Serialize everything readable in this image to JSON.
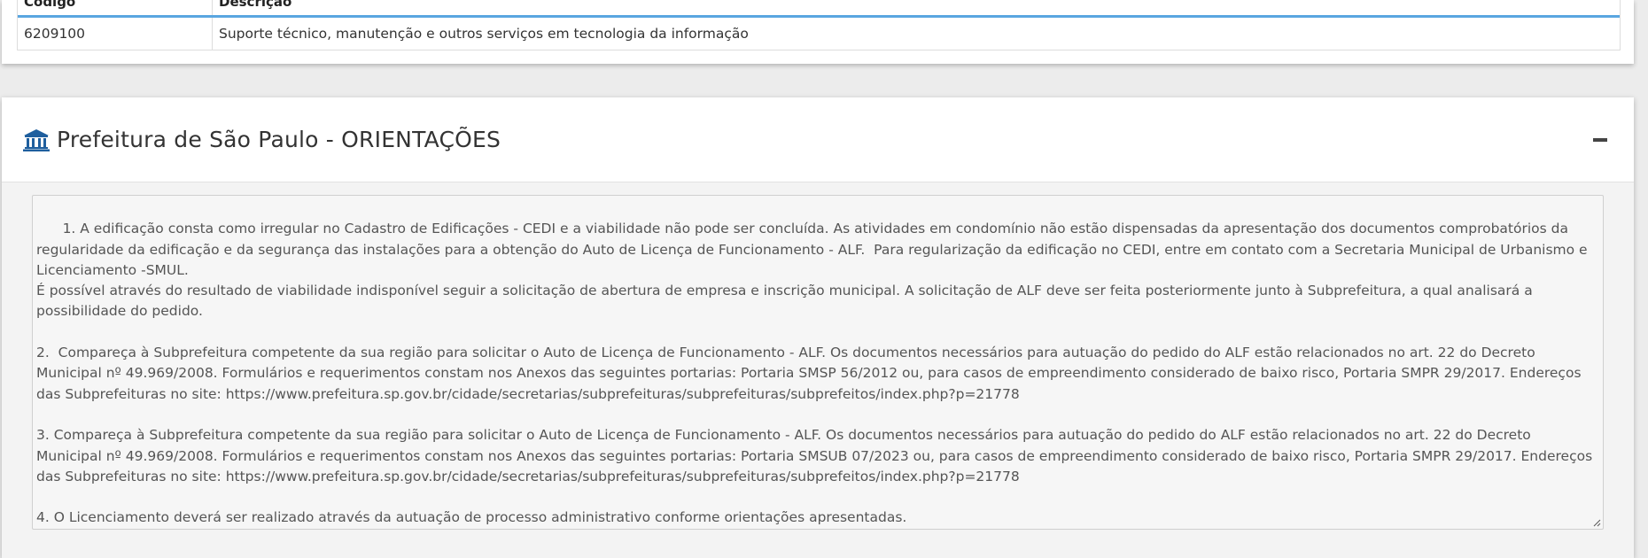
{
  "cnae_table": {
    "headers": [
      "Código",
      "Descrição"
    ],
    "rows": [
      {
        "code": "6209100",
        "description": "Suporte técnico, manutenção e outros serviços em tecnologia da informação"
      }
    ]
  },
  "panel": {
    "icon": "bank-icon",
    "title": "Prefeitura de São Paulo - ORIENTAÇÕES",
    "collapse_icon": "minus-icon",
    "orientations_text": "1. A edificação consta como irregular no Cadastro de Edificações - CEDI e a viabilidade não pode ser concluída. As atividades em condomínio não estão dispensadas da apresentação dos documentos comprobatórios da regularidade da edificação e da segurança das instalações para a obtenção do Auto de Licença de Funcionamento - ALF.  Para regularização da edificação no CEDI, entre em contato com a Secretaria Municipal de Urbanismo e Licenciamento -SMUL.\nÉ possível através do resultado de viabilidade indisponível seguir a solicitação de abertura de empresa e inscrição municipal. A solicitação de ALF deve ser feita posteriormente junto à Subprefeitura, a qual analisará a possibilidade do pedido.\n\n2.  Compareça à Subprefeitura competente da sua região para solicitar o Auto de Licença de Funcionamento - ALF. Os documentos necessários para autuação do pedido do ALF estão relacionados no art. 22 do Decreto Municipal nº 49.969/2008. Formulários e requerimentos constam nos Anexos das seguintes portarias: Portaria SMSP 56/2012 ou, para casos de empreendimento considerado de baixo risco, Portaria SMPR 29/2017. Endereços das Subprefeituras no site: https://www.prefeitura.sp.gov.br/cidade/secretarias/subprefeituras/subprefeituras/subprefeitos/index.php?p=21778\n\n3. Compareça à Subprefeitura competente da sua região para solicitar o Auto de Licença de Funcionamento - ALF. Os documentos necessários para autuação do pedido do ALF estão relacionados no art. 22 do Decreto Municipal nº 49.969/2008. Formulários e requerimentos constam nos Anexos das seguintes portarias: Portaria SMSUB 07/2023 ou, para casos de empreendimento considerado de baixo risco, Portaria SMPR 29/2017. Endereços das Subprefeituras no site: https://www.prefeitura.sp.gov.br/cidade/secretarias/subprefeituras/subprefeituras/subprefeitos/index.php?p=21778\n\n4. O Licenciamento deverá ser realizado através da autuação de processo administrativo conforme orientações apresentadas."
  },
  "colors": {
    "accent_blue": "#5aa6e0",
    "icon_blue": "#1f5f9e"
  }
}
